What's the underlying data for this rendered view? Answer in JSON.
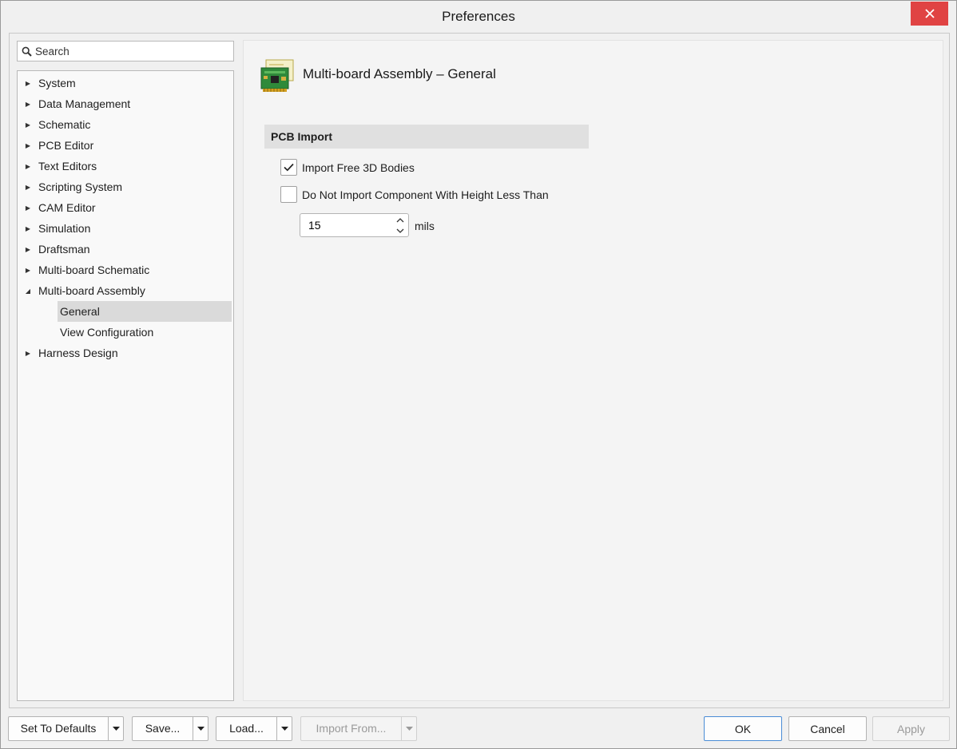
{
  "window": {
    "title": "Preferences"
  },
  "search": {
    "placeholder": "Search"
  },
  "tree": {
    "items": [
      {
        "label": "System"
      },
      {
        "label": "Data Management"
      },
      {
        "label": "Schematic"
      },
      {
        "label": "PCB Editor"
      },
      {
        "label": "Text Editors"
      },
      {
        "label": "Scripting System"
      },
      {
        "label": "CAM Editor"
      },
      {
        "label": "Simulation"
      },
      {
        "label": "Draftsman"
      },
      {
        "label": "Multi-board Schematic"
      },
      {
        "label": "Multi-board Assembly",
        "expanded": true
      },
      {
        "label": "General",
        "child": true,
        "selected": true
      },
      {
        "label": "View Configuration",
        "child": true
      },
      {
        "label": "Harness Design"
      }
    ]
  },
  "page": {
    "title": "Multi-board Assembly – General",
    "icon": "pcb-board-icon",
    "section": "PCB Import",
    "options": {
      "import_free_3d": {
        "label": "Import Free 3D Bodies",
        "checked": true
      },
      "height_filter": {
        "label": "Do Not Import Component With Height Less Than",
        "checked": false
      }
    },
    "height_value": "15",
    "height_unit": "mils"
  },
  "buttons": {
    "set_defaults": "Set To Defaults",
    "save": "Save...",
    "load": "Load...",
    "import_from": "Import From...",
    "ok": "OK",
    "cancel": "Cancel",
    "apply": "Apply"
  },
  "colors": {
    "close": "#e04343",
    "selection": "#dadada",
    "section_bg": "#e0e0e0",
    "ok_border": "#4a8cd6"
  }
}
